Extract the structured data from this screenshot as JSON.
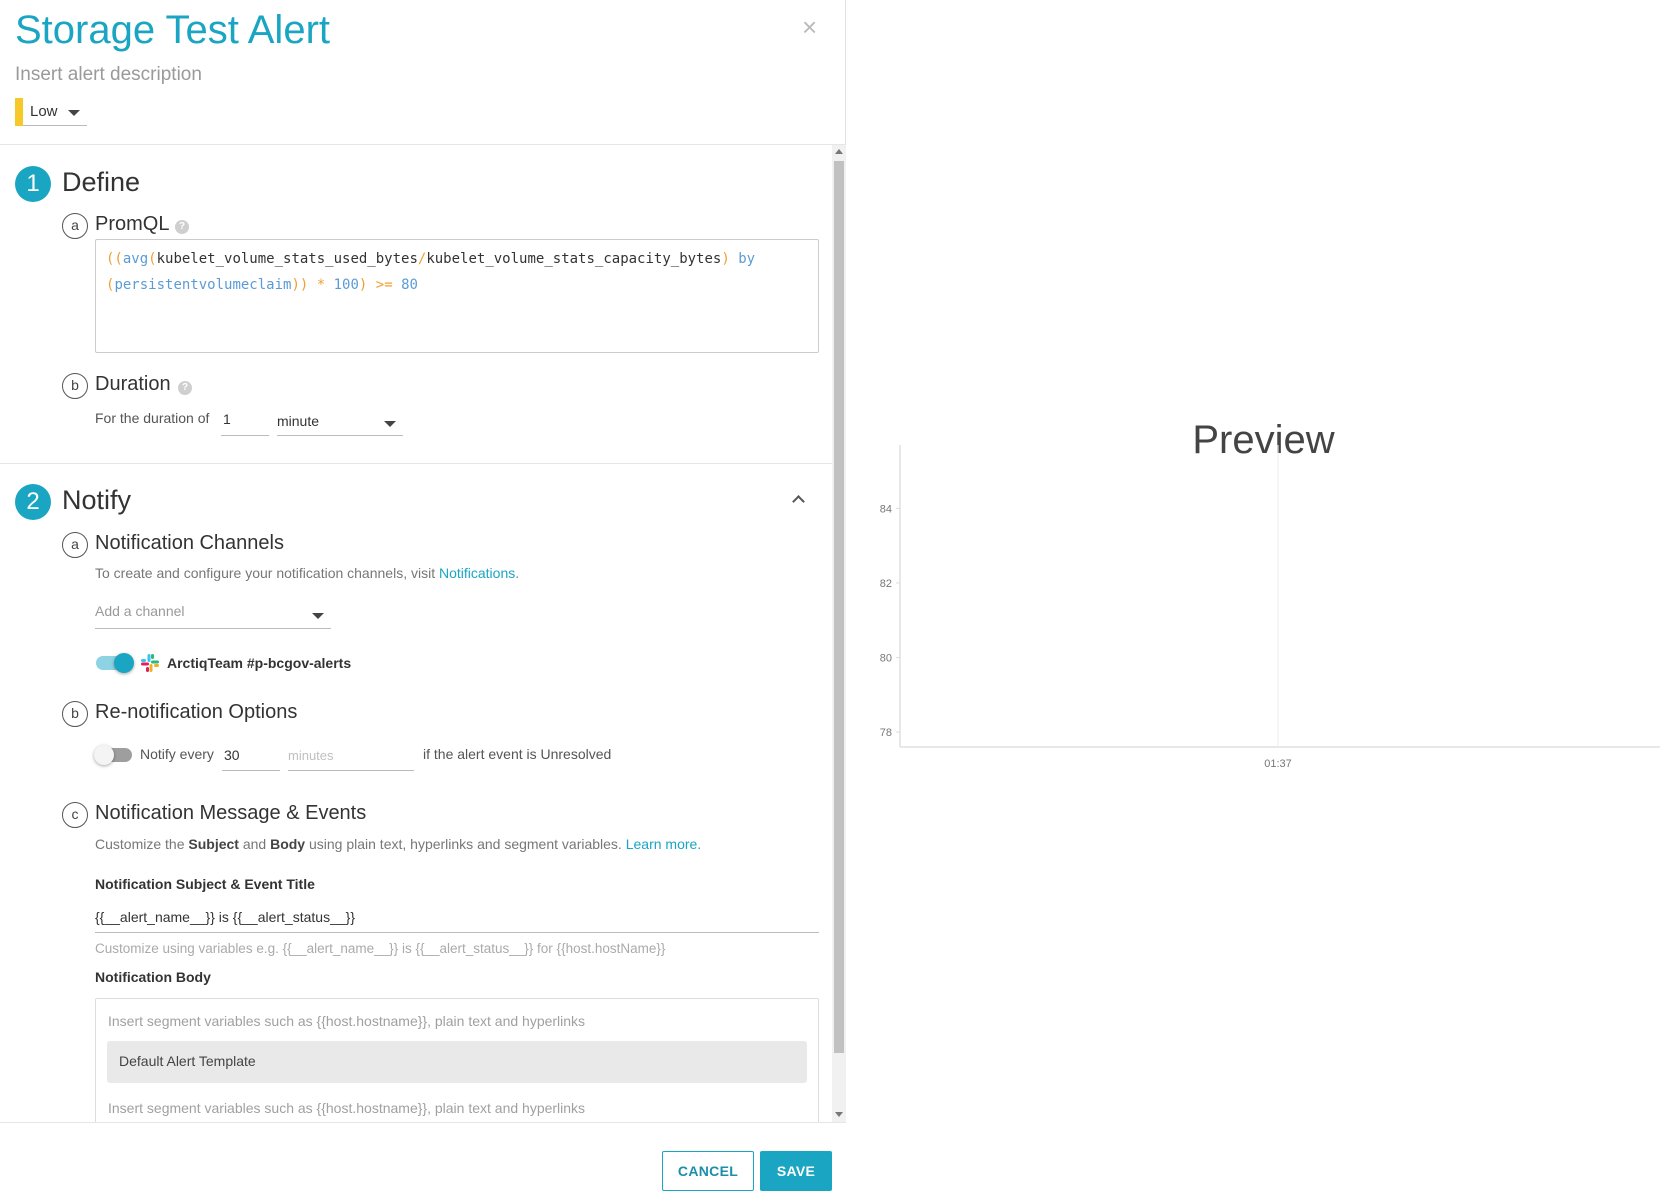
{
  "header": {
    "title": "Storage Test Alert",
    "description_placeholder": "Insert alert description",
    "severity": "Low",
    "severity_color": "#f6c929",
    "close_icon": "close-icon"
  },
  "define": {
    "number": "1",
    "title": "Define",
    "promql": {
      "letter": "a",
      "label": "PromQL",
      "query_line1": [
        "((",
        "avg",
        "(",
        "kubelet_volume_stats_used_bytes",
        "/",
        "kubelet_volume_stats_capacity_bytes",
        ") ",
        "by"
      ],
      "query_line2": [
        "(",
        "persistentvolumeclaim",
        ")) ",
        "* ",
        "100",
        ") ",
        ">= ",
        "80"
      ]
    },
    "duration": {
      "letter": "b",
      "label": "Duration",
      "prefix": "For the duration of",
      "value": "1",
      "unit": "minute"
    }
  },
  "notify": {
    "number": "2",
    "title": "Notify",
    "channels": {
      "letter": "a",
      "label": "Notification Channels",
      "help_text": "To create and configure your notification channels, visit ",
      "help_link": "Notifications",
      "help_suffix": ".",
      "add_placeholder": "Add a channel",
      "items": [
        {
          "name": "ArctiqTeam #p-bcgov-alerts",
          "enabled": true,
          "icon": "slack-icon"
        }
      ]
    },
    "renotify": {
      "letter": "b",
      "label": "Re-notification Options",
      "enabled": false,
      "prefix": "Notify every",
      "value": "30",
      "unit_placeholder": "minutes",
      "suffix": "if the alert event is Unresolved"
    },
    "message": {
      "letter": "c",
      "label": "Notification Message & Events",
      "help_pre": "Customize the ",
      "help_subject": "Subject",
      "help_and": " and ",
      "help_body": "Body",
      "help_post": " using plain text, hyperlinks and segment variables. ",
      "help_link": "Learn more.",
      "subject_label": "Notification Subject & Event Title",
      "subject_value": "{{__alert_name__}} is {{__alert_status__}}",
      "subject_hint": "Customize using variables e.g. {{__alert_name__}} is {{__alert_status__}} for {{host.hostName}}",
      "body_label": "Notification Body",
      "body_placeholder_top": "Insert segment variables such as {{host.hostname}}, plain text and hyperlinks",
      "body_template": "Default Alert Template",
      "body_placeholder_bottom": "Insert segment variables such as {{host.hostname}}, plain text and hyperlinks"
    }
  },
  "footer": {
    "cancel_label": "CANCEL",
    "save_label": "SAVE"
  },
  "preview": {
    "title": "Preview"
  },
  "chart_data": {
    "type": "line",
    "title": "",
    "xlabel": "",
    "ylabel": "",
    "x_ticks": [
      "01:37"
    ],
    "y_ticks": [
      78,
      80,
      82,
      84
    ],
    "ylim": [
      77.6,
      85.7
    ],
    "series": [],
    "grid": false
  }
}
